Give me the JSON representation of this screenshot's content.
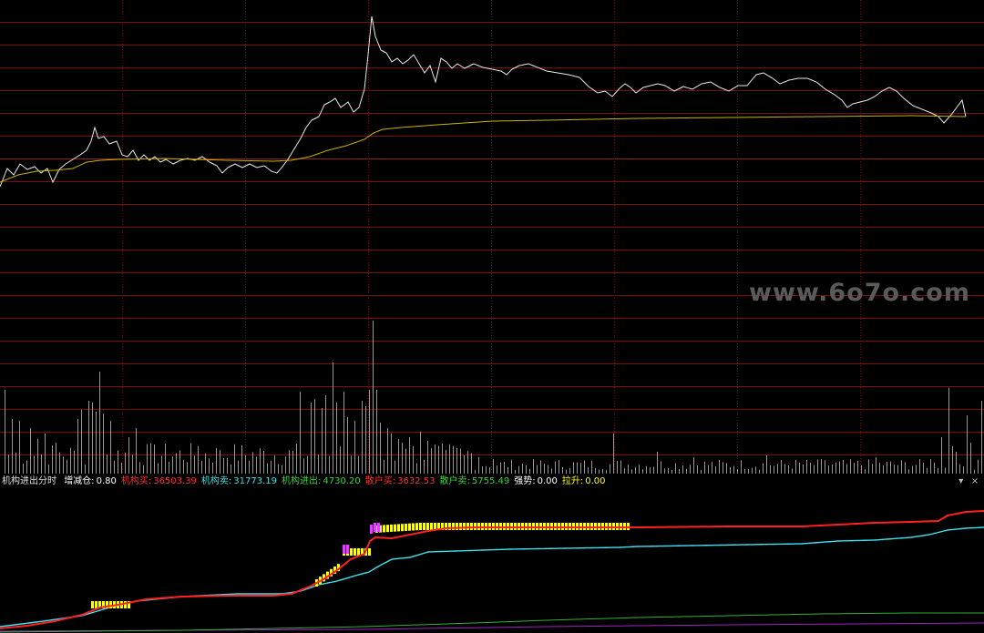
{
  "watermark": "www.6o7o.com",
  "indicator_header": {
    "name": "机构进出分时",
    "items": [
      {
        "label": "增减仓:",
        "value": "0.80",
        "label_color": "#ffffff",
        "value_color": "#ffffff"
      },
      {
        "label": "机构买:",
        "value": "36503.39",
        "label_color": "#ff3030",
        "value_color": "#ff3030"
      },
      {
        "label": "机构卖:",
        "value": "31773.19",
        "label_color": "#40e0e0",
        "value_color": "#40e0e0"
      },
      {
        "label": "机构进出:",
        "value": "4730.20",
        "label_color": "#40d040",
        "value_color": "#40d040"
      },
      {
        "label": "散户买:",
        "value": "3632.53",
        "label_color": "#ff3030",
        "value_color": "#ff3030"
      },
      {
        "label": "散户卖:",
        "value": "5755.49",
        "label_color": "#40d040",
        "value_color": "#40d040"
      },
      {
        "label": "强势:",
        "value": "0.00",
        "label_color": "#ffffff",
        "value_color": "#ffffff"
      },
      {
        "label": "拉升:",
        "value": "0.00",
        "label_color": "#ffff00",
        "value_color": "#ffff00"
      }
    ]
  },
  "controls": {
    "dropdown_icon": "▾",
    "close_icon": "×"
  },
  "colors": {
    "price": "#e8e8e8",
    "avg_price": "#c8b400",
    "volume": "#b0a428",
    "inst_buy": "#ff2020",
    "inst_sell": "#40e0f0",
    "inst_net": "#30b030",
    "retail": "#a020c0",
    "bar_yellow": "#ffff20",
    "bar_magenta": "#e040ff",
    "grid_h": "#7a1010",
    "grid_v": "#5a1010"
  }
}
